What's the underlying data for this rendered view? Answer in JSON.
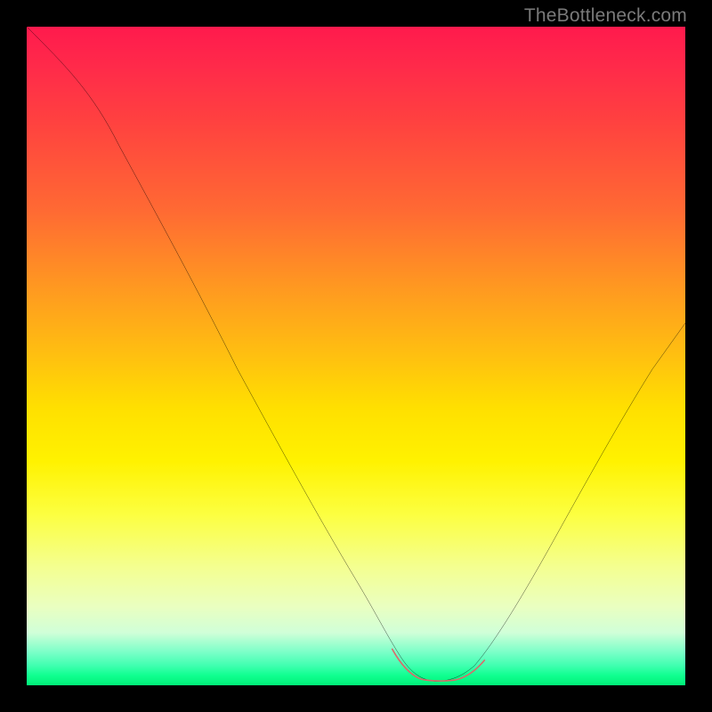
{
  "watermark": {
    "text": "TheBottleneck.com"
  },
  "chart_data": {
    "type": "line",
    "title": "",
    "xlabel": "",
    "ylabel": "",
    "xlim": [
      0,
      100
    ],
    "ylim": [
      0,
      100
    ],
    "series": [
      {
        "name": "bottleneck-curve",
        "x": [
          0,
          5,
          10,
          15,
          20,
          25,
          30,
          35,
          40,
          45,
          50,
          55,
          57,
          60,
          63,
          66,
          70,
          75,
          80,
          85,
          90,
          95,
          100
        ],
        "values": [
          100,
          97,
          92,
          85,
          77,
          68,
          59,
          50,
          41,
          31,
          21,
          10,
          5,
          1,
          0,
          1,
          5,
          13,
          22,
          31,
          40,
          48,
          55
        ]
      }
    ],
    "annotations": [
      {
        "name": "flat-minimum-marker",
        "x_range": [
          56,
          69
        ],
        "y": 0.5,
        "color": "#d96a6a"
      }
    ],
    "background_gradient": {
      "top": "#ff1a4d",
      "mid": "#ffe000",
      "bottom": "#00f078"
    }
  }
}
